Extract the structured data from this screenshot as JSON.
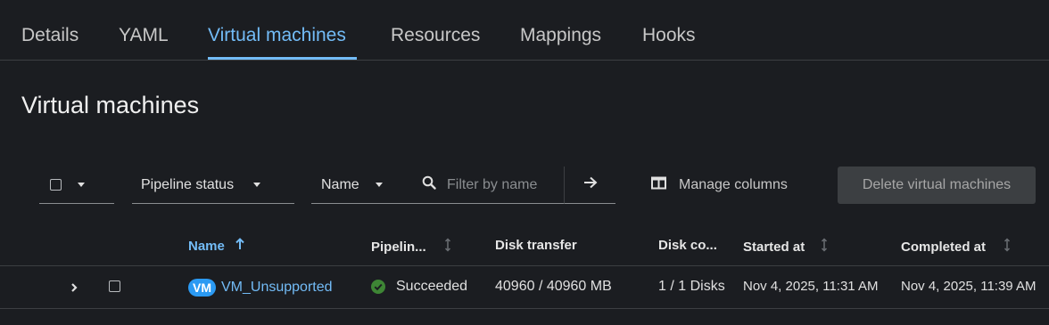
{
  "tabs": [
    {
      "label": "Details"
    },
    {
      "label": "YAML"
    },
    {
      "label": "Virtual machines"
    },
    {
      "label": "Resources"
    },
    {
      "label": "Mappings"
    },
    {
      "label": "Hooks"
    }
  ],
  "active_tab": "Virtual machines",
  "page": {
    "title": "Virtual machines"
  },
  "toolbar": {
    "filter_type_label": "Pipeline status",
    "attribute_label": "Name",
    "search_placeholder": "Filter by name",
    "manage_columns_label": "Manage columns",
    "delete_label": "Delete virtual machines"
  },
  "table": {
    "columns": [
      "Name",
      "Pipelin...",
      "Disk transfer",
      "Disk co...",
      "Started at",
      "Completed at"
    ],
    "rows": [
      {
        "badge": "VM",
        "name": "VM_Unsupported",
        "pipeline": "Succeeded",
        "disk_transfer": "40960 / 40960 MB",
        "disk_count": "1 / 1 Disks",
        "started_at": "Nov 4, 2025, 11:31 AM",
        "completed_at": "Nov 4, 2025, 11:39 AM"
      }
    ]
  },
  "colors": {
    "accent": "#73bcf7",
    "success": "#3e8635",
    "background": "#1b1d21"
  }
}
